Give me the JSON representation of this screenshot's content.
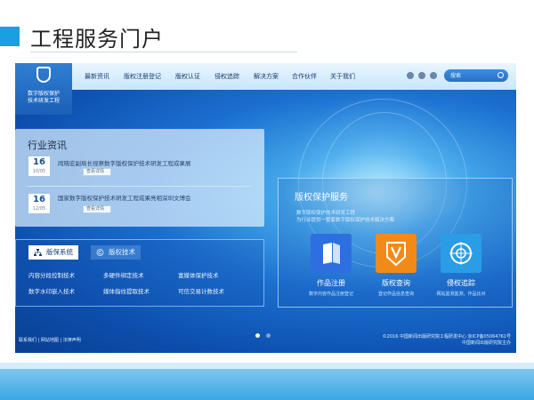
{
  "slide": {
    "title": "工程服务门户"
  },
  "site": {
    "logo": {
      "line1": "数字版权保护",
      "line2": "技术研发工程"
    },
    "nav": [
      "最新资讯",
      "版权注册登记",
      "版权认证",
      "侵权追踪",
      "解决方案",
      "合作伙伴",
      "关于我们"
    ],
    "search_placeholder": "搜索",
    "news": {
      "title": "行业资讯",
      "items": [
        {
          "day": "16",
          "month_day": "10/05",
          "text": "阎晓宏副局长视察数字版权保护技术研发工程成果展",
          "more": "查看详情"
        },
        {
          "day": "16",
          "month_day": "12/05",
          "text": "国家数字版权保护技术研发工程成果亮相深圳文博会",
          "more": "查看详情"
        }
      ]
    },
    "tabs": {
      "active": "版保系统",
      "inactive": "版权技术",
      "items": [
        [
          "内容分段控制技术",
          "多硬件绑定技术",
          "富媒体保护技术"
        ],
        [
          "数字水印嵌入技术",
          "媒体指纹提取技术",
          "可信交易计数技术"
        ]
      ]
    },
    "services": {
      "title": "版权保护服务",
      "sub1": "数字版权保护技术研发工程",
      "sub2": "为行业提供一整套数字版权保护技术解决方案",
      "cards": [
        {
          "label": "作品注册",
          "desc": "数字内容作品注册登记",
          "icon": "book-icon",
          "color": "#2d6fe0"
        },
        {
          "label": "版权查询",
          "desc": "登记作品信息查询",
          "icon": "v-shield-icon",
          "color": "#f28a1a"
        },
        {
          "label": "侵权追踪",
          "desc": "网站监测监测，作品比对",
          "icon": "target-icon",
          "color": "#2a9de6"
        }
      ]
    },
    "footer": {
      "links": "联系我们 | 网站地图 | 法律声明",
      "copyright": "©2016 中国新闻出版研究院工程研发中心 京ICP备05064761号",
      "org": "中国新闻出版研究院主办"
    },
    "colors": {
      "accent": "#1aa0e0",
      "nav_text": "#1b3d6e"
    }
  }
}
